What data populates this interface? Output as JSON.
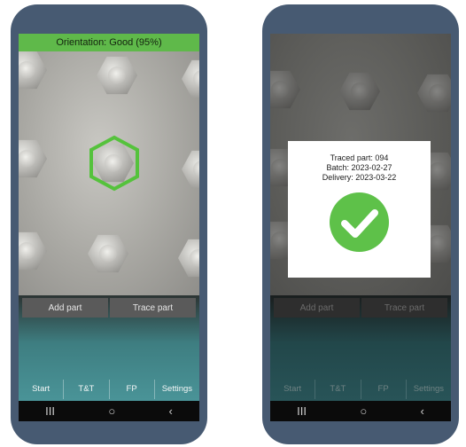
{
  "left_screen": {
    "orientation_status": "Orientation: Good (95%)",
    "buttons": {
      "add_part": "Add part",
      "trace_part": "Trace part"
    },
    "tabs": [
      "Start",
      "T&T",
      "FP",
      "Settings"
    ],
    "nav": {
      "recents": "III",
      "home": "○",
      "back": "‹"
    }
  },
  "right_screen": {
    "dialog": {
      "traced_part": "Traced part: 094",
      "batch": "Batch: 2023-02-27",
      "delivery": "Delivery: 2023-03-22"
    },
    "buttons": {
      "add_part": "Add part",
      "trace_part": "Trace part"
    },
    "tabs": [
      "Start",
      "T&T",
      "FP",
      "Settings"
    ],
    "nav": {
      "recents": "III",
      "home": "○",
      "back": "‹"
    }
  },
  "colors": {
    "status_green": "#5fb94a",
    "highlight_green": "#55c23c",
    "check_green": "#5ec149",
    "phone_frame": "#475a72"
  },
  "icons": {
    "highlight": "hexagon-outline-icon",
    "success": "checkmark-circle-icon",
    "recents": "recents-icon",
    "home": "home-icon",
    "back": "back-icon"
  }
}
